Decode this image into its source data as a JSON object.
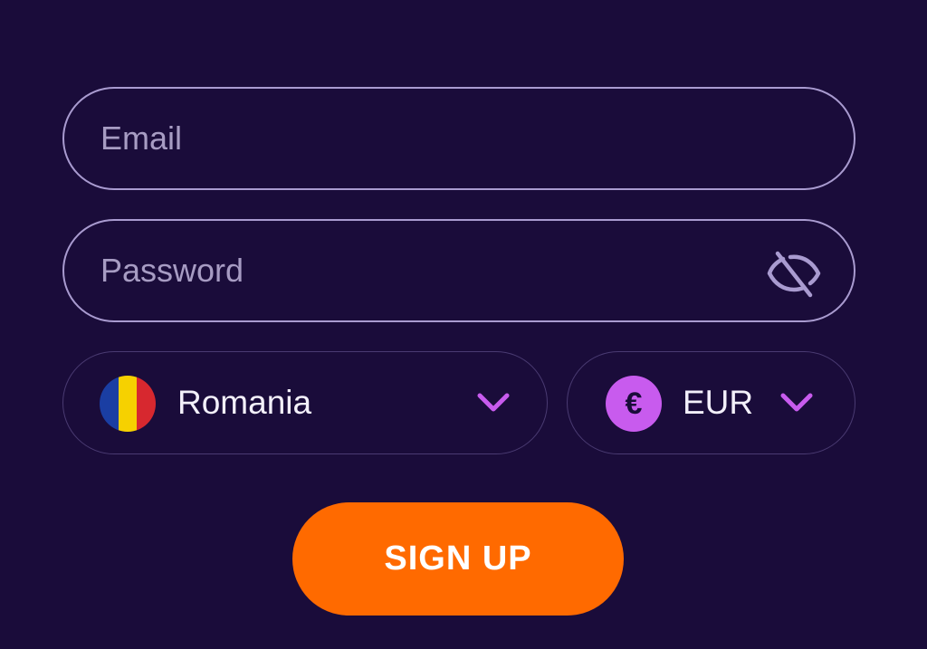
{
  "form": {
    "email": {
      "placeholder": "Email",
      "value": ""
    },
    "password": {
      "placeholder": "Password",
      "value": "",
      "toggle_icon": "eye-slash-icon"
    },
    "country": {
      "label": "Romania",
      "flag_colors": [
        "#1a3ea3",
        "#f6d100",
        "#d7282f"
      ],
      "chevron_icon": "chevron-down-icon"
    },
    "currency": {
      "label": "EUR",
      "symbol": "€",
      "symbol_bg": "#c85bee",
      "chevron_icon": "chevron-down-icon"
    },
    "submit_label": "SIGN UP"
  },
  "colors": {
    "background": "#1a0c3a",
    "accent": "#ff6a00",
    "chevron": "#c85bee",
    "field_border": "#a99bd0"
  }
}
